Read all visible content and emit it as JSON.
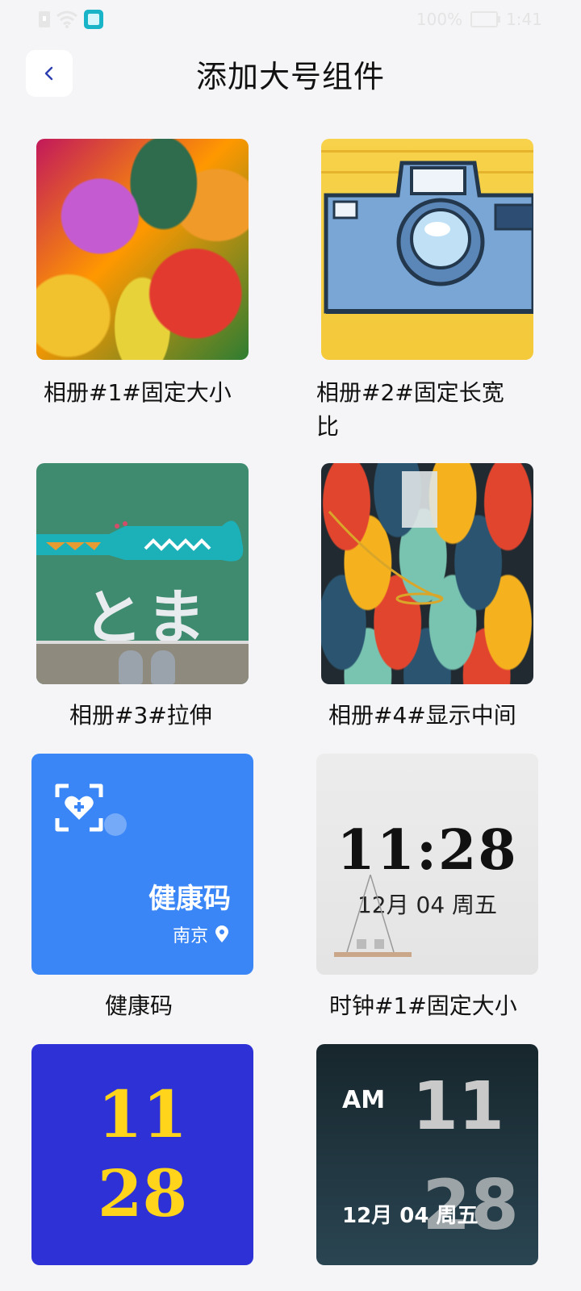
{
  "status_bar": {
    "battery": "100%",
    "time": "1:41"
  },
  "header": {
    "title": "添加大号组件",
    "back_label": "返回"
  },
  "widgets": [
    {
      "label": "相册#1#固定大小"
    },
    {
      "label": "相册#2#固定长宽比"
    },
    {
      "label": "相册#3#拉伸",
      "image_text": "とまれ"
    },
    {
      "label": "相册#4#显示中间"
    },
    {
      "label": "健康码",
      "title": "健康码",
      "city": "南京"
    },
    {
      "label": "时钟#1#固定大小",
      "time": "11:28",
      "date": "12月 04  周五"
    },
    {
      "hours": "11",
      "minutes": "28"
    },
    {
      "ampm": "AM",
      "hours": "11",
      "minutes": "28",
      "date": "12月 04  周五"
    }
  ],
  "colors": {
    "background": "#f5f5f7",
    "health_blue": "#3a86f6",
    "clock2_blue": "#2d31d6",
    "clock2_digits": "#ffd41a"
  }
}
